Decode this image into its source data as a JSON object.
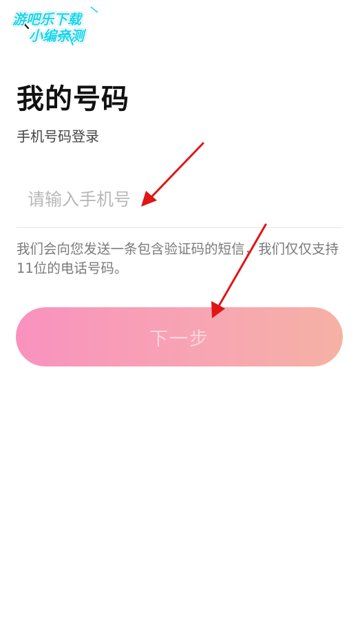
{
  "header": {
    "back_icon": "chevron-left-icon"
  },
  "watermark": {
    "line1": "游吧乐下载",
    "line2": "小编亲测",
    "color": "#17d6ec"
  },
  "login": {
    "title": "我的号码",
    "subtitle": "手机号码登录",
    "phone_input": {
      "value": "",
      "placeholder": "请输入手机号"
    },
    "hint": "我们会向您发送一条包含验证码的短信，我们仅仅支持11位的电话号码。",
    "next_button_label": "下一步"
  },
  "colors": {
    "button_gradient_start": "#f992bf",
    "button_gradient_end": "#f6b1a4",
    "annotation_arrow": "#e01515"
  }
}
